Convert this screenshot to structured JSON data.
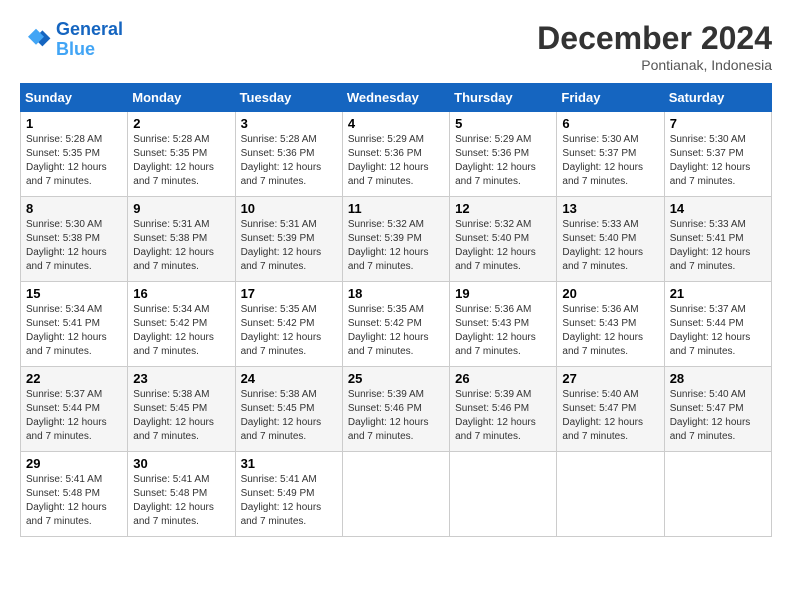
{
  "header": {
    "logo_line1": "General",
    "logo_line2": "Blue",
    "month": "December 2024",
    "location": "Pontianak, Indonesia"
  },
  "days_of_week": [
    "Sunday",
    "Monday",
    "Tuesday",
    "Wednesday",
    "Thursday",
    "Friday",
    "Saturday"
  ],
  "weeks": [
    [
      {
        "day": "1",
        "sunrise": "5:28 AM",
        "sunset": "5:35 PM",
        "daylight": "12 hours and 7 minutes."
      },
      {
        "day": "2",
        "sunrise": "5:28 AM",
        "sunset": "5:35 PM",
        "daylight": "12 hours and 7 minutes."
      },
      {
        "day": "3",
        "sunrise": "5:28 AM",
        "sunset": "5:36 PM",
        "daylight": "12 hours and 7 minutes."
      },
      {
        "day": "4",
        "sunrise": "5:29 AM",
        "sunset": "5:36 PM",
        "daylight": "12 hours and 7 minutes."
      },
      {
        "day": "5",
        "sunrise": "5:29 AM",
        "sunset": "5:36 PM",
        "daylight": "12 hours and 7 minutes."
      },
      {
        "day": "6",
        "sunrise": "5:30 AM",
        "sunset": "5:37 PM",
        "daylight": "12 hours and 7 minutes."
      },
      {
        "day": "7",
        "sunrise": "5:30 AM",
        "sunset": "5:37 PM",
        "daylight": "12 hours and 7 minutes."
      }
    ],
    [
      {
        "day": "8",
        "sunrise": "5:30 AM",
        "sunset": "5:38 PM",
        "daylight": "12 hours and 7 minutes."
      },
      {
        "day": "9",
        "sunrise": "5:31 AM",
        "sunset": "5:38 PM",
        "daylight": "12 hours and 7 minutes."
      },
      {
        "day": "10",
        "sunrise": "5:31 AM",
        "sunset": "5:39 PM",
        "daylight": "12 hours and 7 minutes."
      },
      {
        "day": "11",
        "sunrise": "5:32 AM",
        "sunset": "5:39 PM",
        "daylight": "12 hours and 7 minutes."
      },
      {
        "day": "12",
        "sunrise": "5:32 AM",
        "sunset": "5:40 PM",
        "daylight": "12 hours and 7 minutes."
      },
      {
        "day": "13",
        "sunrise": "5:33 AM",
        "sunset": "5:40 PM",
        "daylight": "12 hours and 7 minutes."
      },
      {
        "day": "14",
        "sunrise": "5:33 AM",
        "sunset": "5:41 PM",
        "daylight": "12 hours and 7 minutes."
      }
    ],
    [
      {
        "day": "15",
        "sunrise": "5:34 AM",
        "sunset": "5:41 PM",
        "daylight": "12 hours and 7 minutes."
      },
      {
        "day": "16",
        "sunrise": "5:34 AM",
        "sunset": "5:42 PM",
        "daylight": "12 hours and 7 minutes."
      },
      {
        "day": "17",
        "sunrise": "5:35 AM",
        "sunset": "5:42 PM",
        "daylight": "12 hours and 7 minutes."
      },
      {
        "day": "18",
        "sunrise": "5:35 AM",
        "sunset": "5:42 PM",
        "daylight": "12 hours and 7 minutes."
      },
      {
        "day": "19",
        "sunrise": "5:36 AM",
        "sunset": "5:43 PM",
        "daylight": "12 hours and 7 minutes."
      },
      {
        "day": "20",
        "sunrise": "5:36 AM",
        "sunset": "5:43 PM",
        "daylight": "12 hours and 7 minutes."
      },
      {
        "day": "21",
        "sunrise": "5:37 AM",
        "sunset": "5:44 PM",
        "daylight": "12 hours and 7 minutes."
      }
    ],
    [
      {
        "day": "22",
        "sunrise": "5:37 AM",
        "sunset": "5:44 PM",
        "daylight": "12 hours and 7 minutes."
      },
      {
        "day": "23",
        "sunrise": "5:38 AM",
        "sunset": "5:45 PM",
        "daylight": "12 hours and 7 minutes."
      },
      {
        "day": "24",
        "sunrise": "5:38 AM",
        "sunset": "5:45 PM",
        "daylight": "12 hours and 7 minutes."
      },
      {
        "day": "25",
        "sunrise": "5:39 AM",
        "sunset": "5:46 PM",
        "daylight": "12 hours and 7 minutes."
      },
      {
        "day": "26",
        "sunrise": "5:39 AM",
        "sunset": "5:46 PM",
        "daylight": "12 hours and 7 minutes."
      },
      {
        "day": "27",
        "sunrise": "5:40 AM",
        "sunset": "5:47 PM",
        "daylight": "12 hours and 7 minutes."
      },
      {
        "day": "28",
        "sunrise": "5:40 AM",
        "sunset": "5:47 PM",
        "daylight": "12 hours and 7 minutes."
      }
    ],
    [
      {
        "day": "29",
        "sunrise": "5:41 AM",
        "sunset": "5:48 PM",
        "daylight": "12 hours and 7 minutes."
      },
      {
        "day": "30",
        "sunrise": "5:41 AM",
        "sunset": "5:48 PM",
        "daylight": "12 hours and 7 minutes."
      },
      {
        "day": "31",
        "sunrise": "5:41 AM",
        "sunset": "5:49 PM",
        "daylight": "12 hours and 7 minutes."
      },
      null,
      null,
      null,
      null
    ]
  ]
}
